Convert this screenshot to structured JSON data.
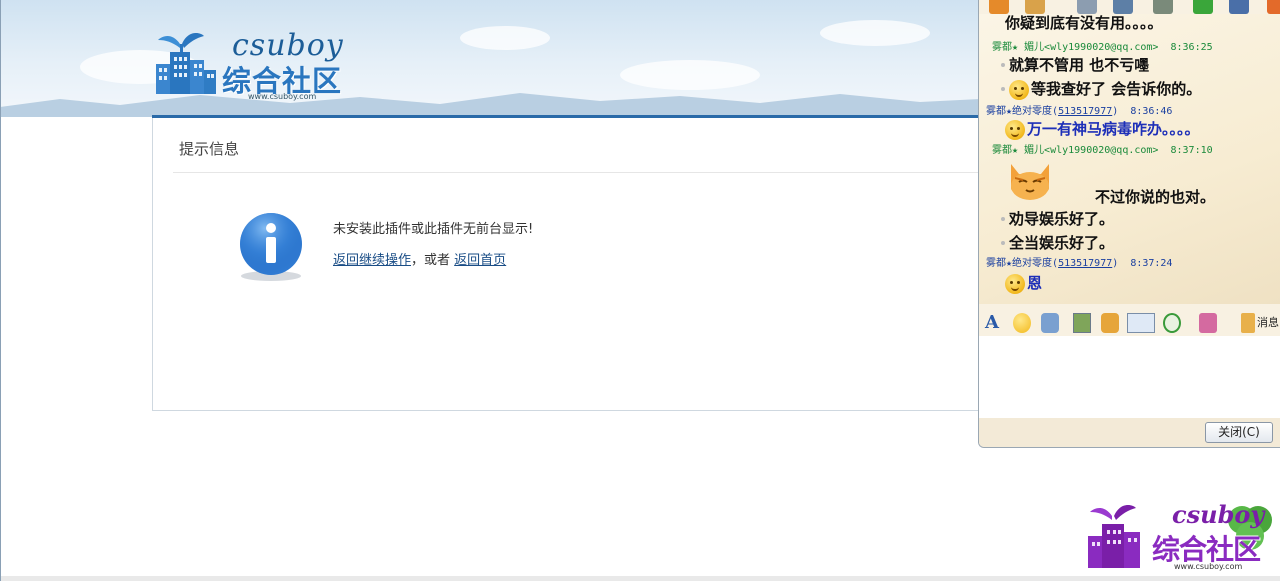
{
  "brand": {
    "latin": "csuboy",
    "chinese": "综合社区",
    "url": "www.csuboy.com"
  },
  "notice": {
    "title": "提示信息",
    "message": "未安装此插件或此插件无前台显示!",
    "link_back": "返回继续操作",
    "separator": "，或者",
    "link_home": "返回首页"
  },
  "chat": {
    "messages": [
      {
        "kind": "text",
        "text": "你疑到底有没有用。。。。"
      },
      {
        "kind": "header",
        "name": "雾都★ 媚儿",
        "contact": "<wly1990020@qq.com>",
        "time": "8:36:25",
        "color": "#1a8a3a"
      },
      {
        "kind": "text",
        "text": "就算不管用  也不亏嚜"
      },
      {
        "kind": "text",
        "text": "等我查好了  会告诉你的。",
        "emoticon": true
      },
      {
        "kind": "header",
        "name": "雾都★绝对零度",
        "contact": "513517977",
        "time": "8:36:46",
        "color": "#1a3fa0"
      },
      {
        "kind": "text",
        "text": "万一有神马病毒咋办。。。。",
        "emoticon": true,
        "color": "#1d2fb8"
      },
      {
        "kind": "header",
        "name": "雾都★ 媚儿",
        "contact": "<wly1990020@qq.com>",
        "time": "8:37:10",
        "color": "#1a8a3a"
      },
      {
        "kind": "text",
        "text": "不过你说的也对。"
      },
      {
        "kind": "text",
        "text": "劝导娱乐好了。"
      },
      {
        "kind": "text",
        "text": "全当娱乐好了。"
      },
      {
        "kind": "header",
        "name": "雾都★绝对零度",
        "contact": "513517977",
        "time": "8:37:24",
        "color": "#1a3fa0"
      },
      {
        "kind": "text",
        "text": "恩",
        "emoticon": true,
        "color": "#1d2fb8"
      }
    ],
    "toolbar": {
      "font_icon": "font-icon",
      "emoticon_icon": "smiley-icon",
      "shake_icon": "magic-emoticon-icon",
      "image_icon": "image-icon",
      "snapshot_icon": "snapshot-icon",
      "screen_icon": "screenshot-icon",
      "music_icon": "music-icon",
      "more_icon": "more-icon",
      "history_label": "消息"
    },
    "close_button": "关闭(C)"
  },
  "watermark": {
    "latin": "csuboy",
    "chinese": "综合社区",
    "url": "www.csuboy.com"
  },
  "colors": {
    "link": "#1a4d86",
    "brand_blue": "#2a76bf",
    "watermark_purple": "#8a2bc0"
  }
}
